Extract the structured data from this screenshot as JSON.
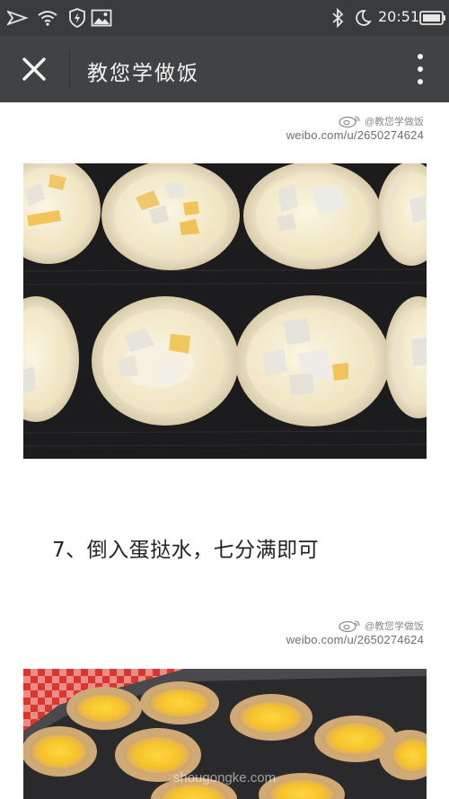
{
  "status_bar": {
    "time": "20:51",
    "icons": [
      "airplane-mode-icon",
      "wifi-icon",
      "shield-icon",
      "image-icon",
      "bluetooth-icon",
      "do-not-disturb-moon-icon",
      "battery-icon"
    ]
  },
  "app_bar": {
    "close_icon": "close-icon",
    "title": "教您学做饭",
    "menu_icon": "more-vertical-icon"
  },
  "content": {
    "watermark_1": {
      "name": "@教您学做饭",
      "url": "weibo.com/u/2650274624"
    },
    "photo_1_alt": "egg tart shells with custard and mango",
    "step_text": "7、倒入蛋挞水，七分满即可",
    "watermark_2": {
      "name": "@教您学做饭",
      "url": "weibo.com/u/2650274624"
    },
    "photo_2_alt": "baked egg tarts with mango",
    "site_watermark": "shougongke.com"
  },
  "colors": {
    "status_bar_bg": "#3a3b3d",
    "app_bar_bg": "#404244",
    "page_bg": "#ffffff"
  }
}
